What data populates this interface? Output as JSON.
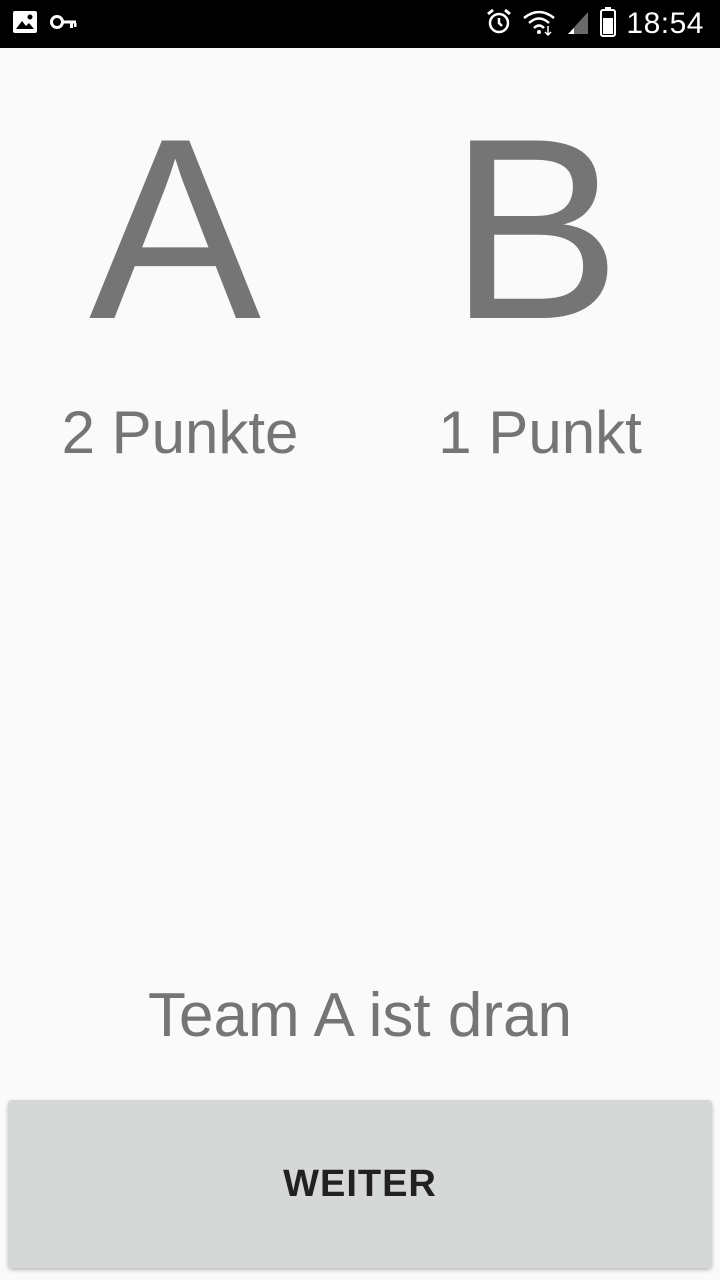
{
  "status_bar": {
    "time": "18:54",
    "icons": [
      "image-icon",
      "key-icon",
      "alarm-icon",
      "wifi-icon",
      "signal-icon",
      "battery-icon"
    ]
  },
  "teams": [
    {
      "letter": "A",
      "score": "2 Punkte"
    },
    {
      "letter": "B",
      "score": "1 Punkt"
    }
  ],
  "turn_text": "Team A ist dran",
  "next_button_label": "WEITER",
  "colors": {
    "background": "#fafafa",
    "text_gray": "#757575",
    "button_bg": "#d6d7d7",
    "button_text": "#212121",
    "status_bar": "#000000"
  }
}
